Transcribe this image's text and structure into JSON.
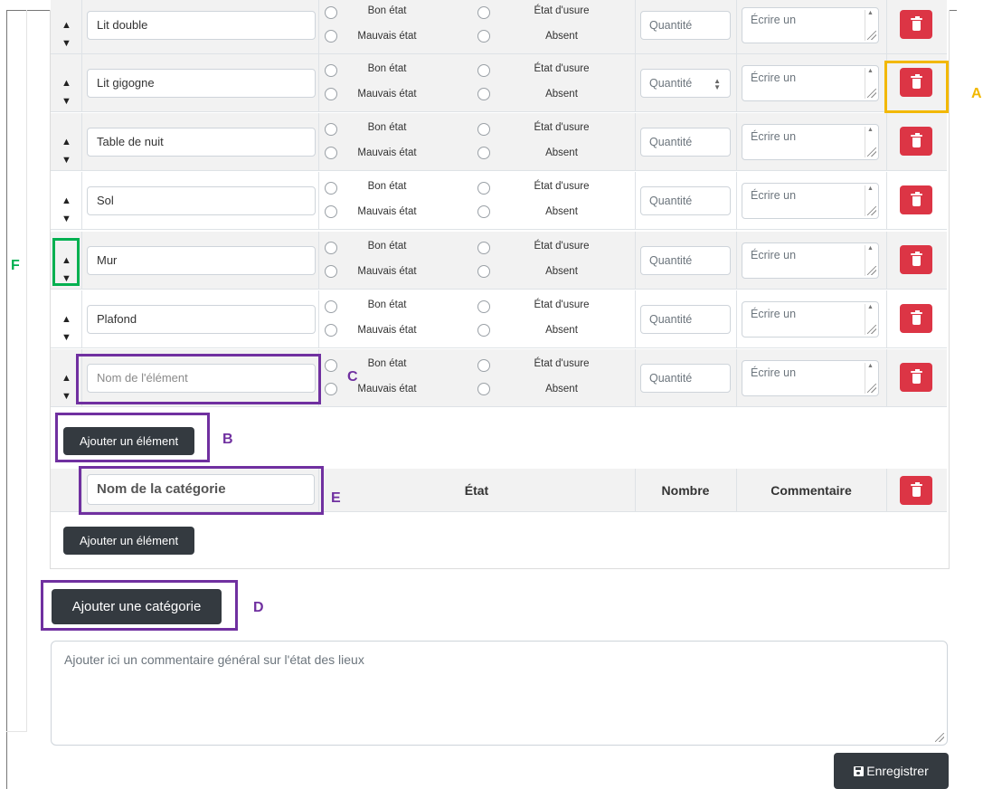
{
  "rows": [
    {
      "name": "Lit double",
      "good": "Bon état",
      "worn": "État d'usure",
      "bad": "Mauvais état",
      "absent": "Absent",
      "qty": "Quantité",
      "comment": "Écrire un"
    },
    {
      "name": "Lit gigogne",
      "good": "Bon état",
      "worn": "État d'usure",
      "bad": "Mauvais état",
      "absent": "Absent",
      "qty": "Quantité",
      "comment": "Écrire un"
    },
    {
      "name": "Table de nuit",
      "good": "Bon état",
      "worn": "État d'usure",
      "bad": "Mauvais état",
      "absent": "Absent",
      "qty": "Quantité",
      "comment": "Écrire un"
    },
    {
      "name": "Sol",
      "good": "Bon état",
      "worn": "État d'usure",
      "bad": "Mauvais état",
      "absent": "Absent",
      "qty": "Quantité",
      "comment": "Écrire un"
    },
    {
      "name": "Mur",
      "good": "Bon état",
      "worn": "État d'usure",
      "bad": "Mauvais état",
      "absent": "Absent",
      "qty": "Quantité",
      "comment": "Écrire un"
    },
    {
      "name": "Plafond",
      "good": "Bon état",
      "worn": "État d'usure",
      "bad": "Mauvais état",
      "absent": "Absent",
      "qty": "Quantité",
      "comment": "Écrire un"
    },
    {
      "name_placeholder": "Nom de l'élément",
      "good": "Bon état",
      "worn": "État d'usure",
      "bad": "Mauvais état",
      "absent": "Absent",
      "qty": "Quantité",
      "comment": "Écrire un"
    }
  ],
  "add_element_label": "Ajouter un élément",
  "category": {
    "name_placeholder": "Nom de la catégorie",
    "col_state": "État",
    "col_count": "Nombre",
    "col_comment": "Commentaire"
  },
  "add_element_label_2": "Ajouter un élément",
  "add_category_label": "Ajouter une catégorie",
  "general_comment_placeholder": "Ajouter ici un commentaire général sur l'état des lieux",
  "save_label": "Enregistrer",
  "annotations": {
    "a": "A",
    "b": "B",
    "c": "C",
    "d": "D",
    "e": "E",
    "f": "F"
  },
  "colors": {
    "danger": "#dc3545",
    "dark": "#343a40",
    "annotation_purple": "#7030a0",
    "annotation_yellow": "#f2b800",
    "annotation_green": "#00b050"
  }
}
